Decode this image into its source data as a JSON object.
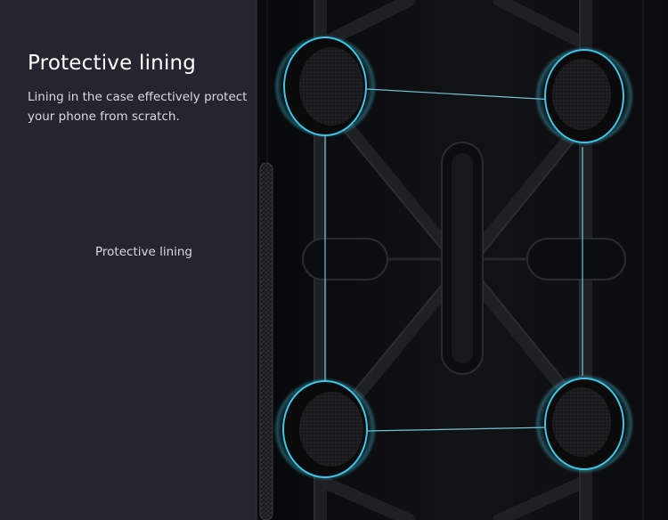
{
  "heading": {
    "title": "Protective lining",
    "description": "Lining in the case effectively protect your phone from scratch."
  },
  "callout": {
    "label": "Protective lining"
  },
  "colors": {
    "background": "#23262e",
    "case_black": "#0d0e10",
    "highlight_ring": "#3fc6e6",
    "connector_line": "#7fd6ee",
    "title_text": "#ffffff",
    "body_text": "#d9dbe0"
  },
  "lining_pads": {
    "count": 4,
    "material": "fabric"
  }
}
